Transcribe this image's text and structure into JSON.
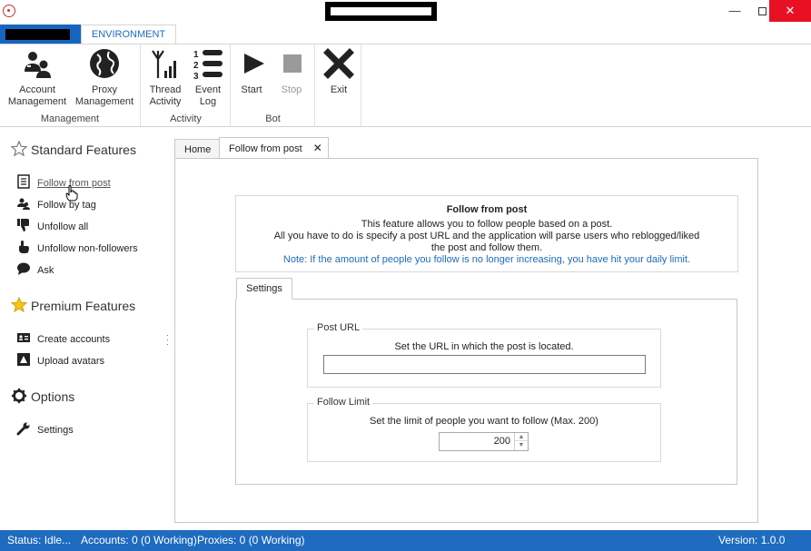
{
  "window": {
    "minimize_glyph": "—",
    "close_glyph": "✕"
  },
  "ribbon": {
    "tab_environment": "ENVIRONMENT",
    "groups": {
      "management": "Management",
      "activity": "Activity",
      "bot": "Bot"
    },
    "buttons": {
      "account_management": "Account Management",
      "proxy_management": "Proxy Management",
      "thread_activity": "Thread Activity",
      "event_log": "Event Log",
      "start": "Start",
      "stop": "Stop",
      "exit": "Exit"
    }
  },
  "sidebar": {
    "standard_header": "Standard Features",
    "standard_items": [
      "Follow from post",
      "Follow by tag",
      "Unfollow all",
      "Unfollow non-followers",
      "Ask"
    ],
    "premium_header": "Premium Features",
    "premium_items": [
      "Create accounts",
      "Upload avatars"
    ],
    "options_header": "Options",
    "options_items": [
      "Settings"
    ]
  },
  "content_tabs": {
    "home": "Home",
    "active": "Follow from post"
  },
  "info": {
    "title": "Follow from post",
    "line1": "This feature allows you to follow people based on a post.",
    "line2": "All you have to do is specify a post URL and the application will parse users who reblogged/liked",
    "line3": "the post and follow them.",
    "note": "Note: If the amount of people you follow is no longer increasing, you have hit your daily limit."
  },
  "settings": {
    "tab_label": "Settings",
    "post_url": {
      "legend": "Post URL",
      "description": "Set the URL in which the post is located.",
      "value": ""
    },
    "follow_limit": {
      "legend": "Follow Limit",
      "description": "Set the limit of people you want to follow (Max. 200)",
      "value": "200"
    }
  },
  "status": {
    "status": "Status: Idle...",
    "accounts": "Accounts: 0 (0 Working)",
    "proxies": "Proxies: 0 (0 Working)",
    "version": "Version: 1.0.0"
  },
  "colors": {
    "accent": "#1e6bbf",
    "file_tab": "#1565c0",
    "close_button": "#e81123"
  }
}
